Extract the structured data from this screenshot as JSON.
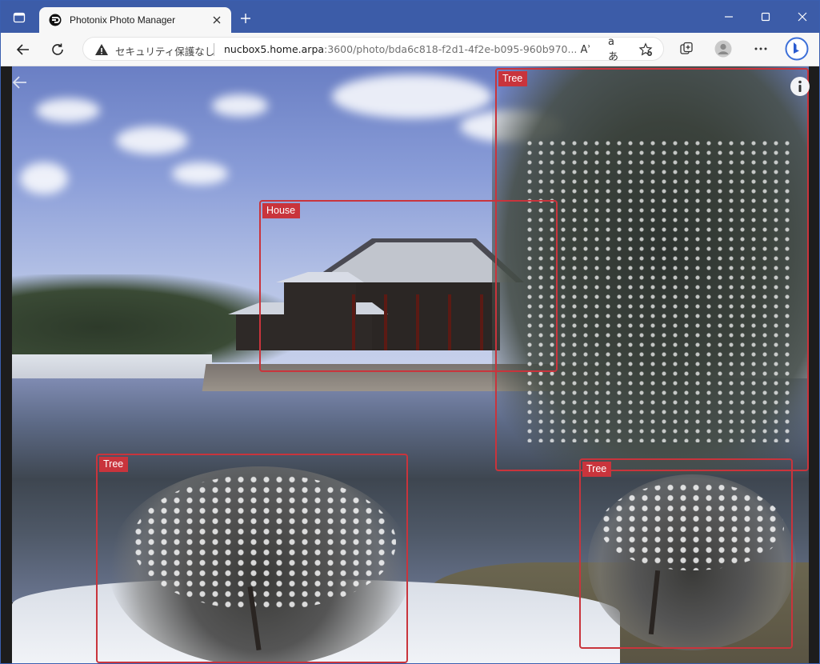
{
  "browser": {
    "tab": {
      "title": "Photonix Photo Manager"
    },
    "address": {
      "security_label": "セキュリティ保護なし",
      "host": "nucbox5.home.arpa",
      "rest": ":3600/photo/bda6c818-f2d1-4f2e-b095-960b970..."
    },
    "reader_aa": "Aʾ",
    "read_aloud": "aあ"
  },
  "photo": {
    "detections": [
      {
        "label": "Tree"
      },
      {
        "label": "House"
      },
      {
        "label": "Tree"
      },
      {
        "label": "Tree"
      }
    ]
  },
  "colors": {
    "titlebar": "#3c5ca8",
    "toolbar": "#f7f7f7",
    "bbox": "#c9343c"
  },
  "icons": [
    "sidebar-icon",
    "app-favicon",
    "close-icon",
    "plus-icon",
    "minimize-icon",
    "maximize-icon",
    "back-arrow-icon",
    "refresh-icon",
    "warning-icon",
    "read-aloud-icon",
    "favorites-icon",
    "collections-icon",
    "profile-icon",
    "more-icon",
    "bing-icon",
    "photo-back-icon",
    "info-icon"
  ]
}
